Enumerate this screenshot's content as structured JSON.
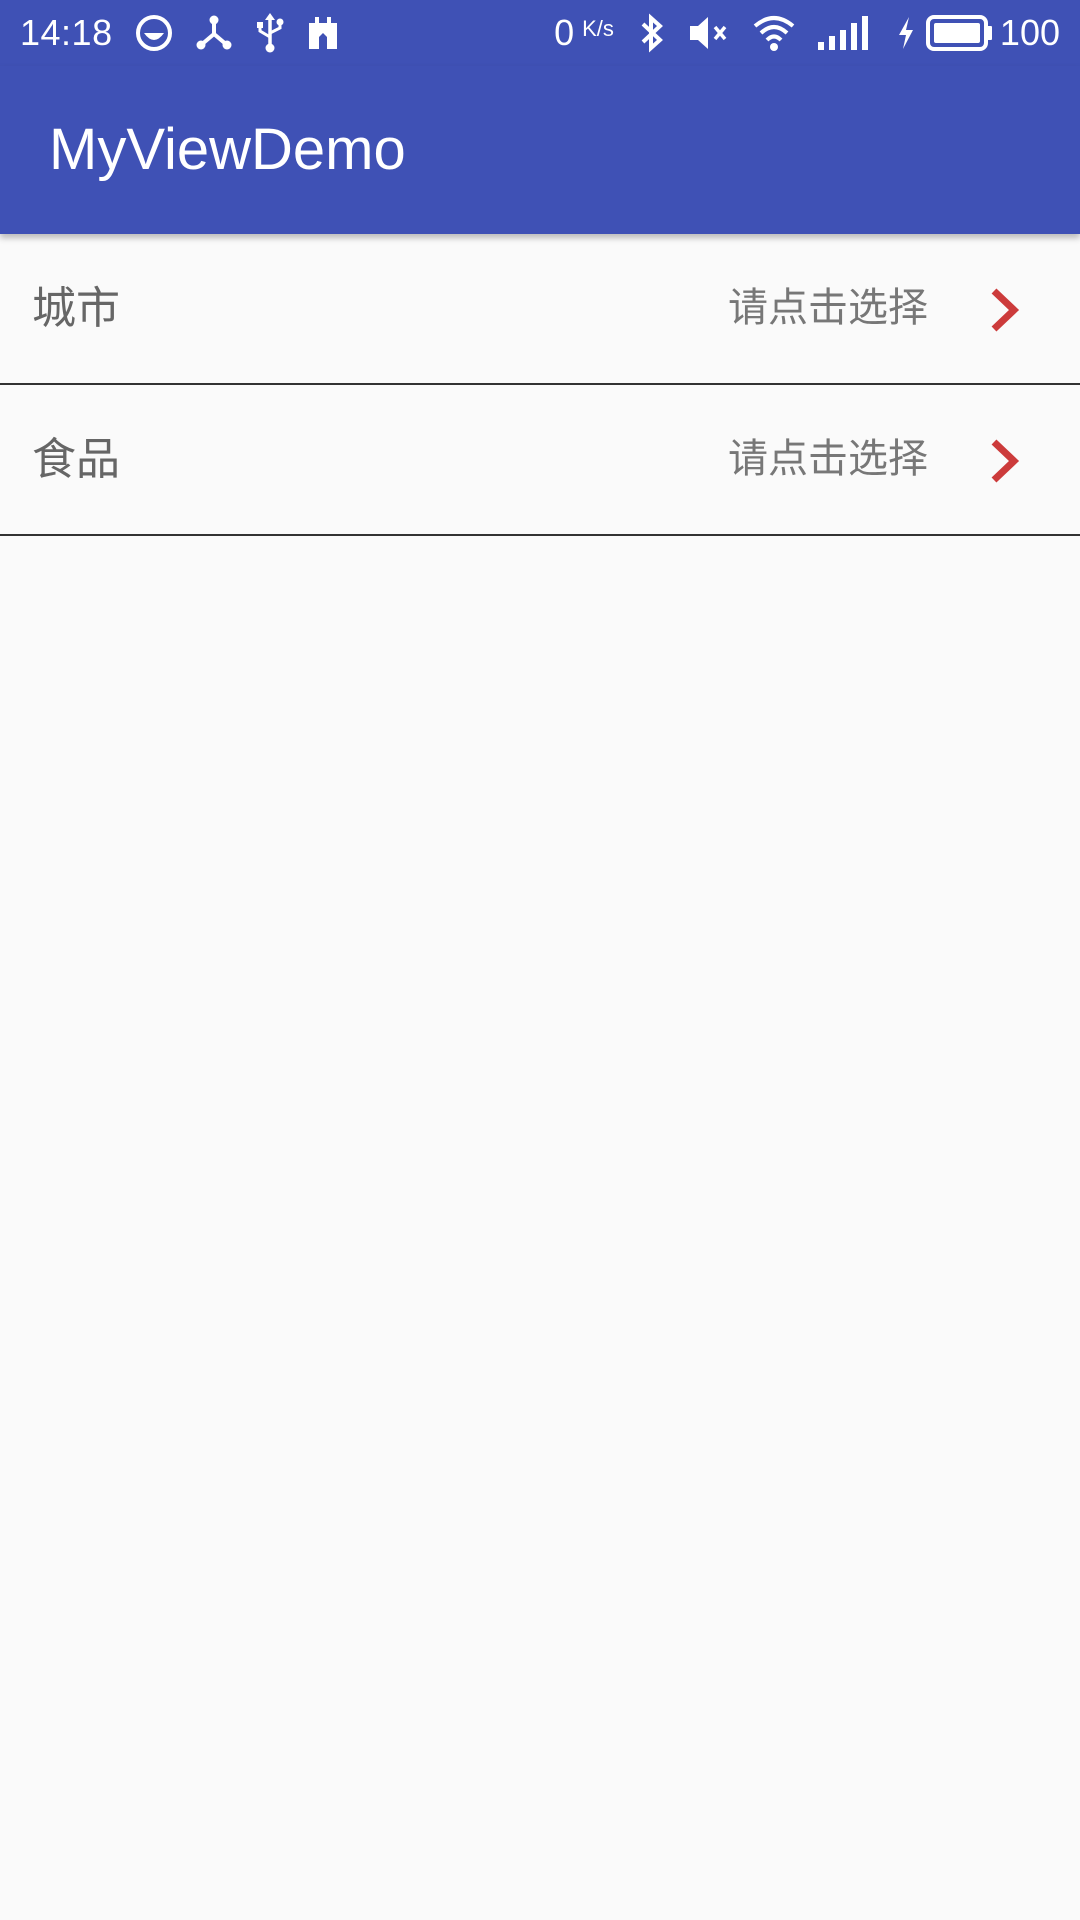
{
  "status_bar": {
    "time": "14:18",
    "net_speed_value": "0",
    "net_speed_unit": "K/s",
    "battery_level": "100",
    "icons_left": [
      "face-icon",
      "share-hub-icon",
      "usb-icon",
      "calendar-icon"
    ],
    "icons_right": [
      "bluetooth-icon",
      "mute-icon",
      "wifi-icon",
      "signal-icon",
      "charging-icon",
      "battery-icon"
    ]
  },
  "app_bar": {
    "title": "MyViewDemo",
    "color": "#3f51b5"
  },
  "list": {
    "rows": [
      {
        "label": "城市",
        "value": "请点击选择"
      },
      {
        "label": "食品",
        "value": "请点击选择"
      }
    ],
    "arrow_color": "#cc3b3b"
  }
}
